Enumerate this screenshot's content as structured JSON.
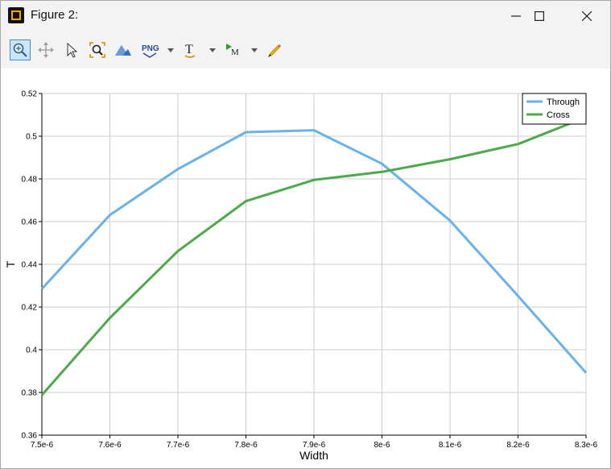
{
  "window": {
    "title": "Figure 2:",
    "minimize_icon": "minimize-icon",
    "maximize_icon": "maximize-icon",
    "close_icon": "close-icon"
  },
  "toolbar": {
    "buttons": [
      {
        "icon": "zoom-icon",
        "active": true
      },
      {
        "icon": "pan-icon",
        "active": false
      },
      {
        "icon": "select-pointer-icon",
        "active": false
      },
      {
        "icon": "zoom-fit-icon",
        "active": false
      },
      {
        "icon": "mountain-3d-icon",
        "active": false
      },
      {
        "icon": "png-export-icon",
        "label": "PNG",
        "dropdown": true
      },
      {
        "icon": "text-tool-icon",
        "label": "T",
        "dropdown": true
      },
      {
        "icon": "marker-tool-icon",
        "label": "M",
        "dropdown": true
      },
      {
        "icon": "pencil-icon",
        "active": false
      }
    ]
  },
  "colors": {
    "through": "#6ab2ea",
    "cross": "#4caa4c",
    "grid": "#cccccc",
    "active_border": "#3b8fd9"
  },
  "chart_data": {
    "type": "line",
    "title": "",
    "xlabel": "Width",
    "ylabel": "T",
    "x": [
      7.5e-06,
      7.6e-06,
      7.7e-06,
      7.8e-06,
      7.9e-06,
      8e-06,
      8.1e-06,
      8.2e-06,
      8.3e-06
    ],
    "x_tick_labels": [
      "7.5e-6",
      "7.6e-6",
      "7.7e-6",
      "7.8e-6",
      "7.9e-6",
      "8e-6",
      "8.1e-6",
      "8.2e-6",
      "8.3e-6"
    ],
    "xlim": [
      7.5e-06,
      8.3e-06
    ],
    "ylim": [
      0.36,
      0.52
    ],
    "y_ticks": [
      0.36,
      0.38,
      0.4,
      0.42,
      0.44,
      0.46,
      0.48,
      0.5,
      0.52
    ],
    "y_tick_labels": [
      "0.36",
      "0.38",
      "0.4",
      "0.42",
      "0.44",
      "0.46",
      "0.48",
      "0.5",
      "0.52"
    ],
    "grid": true,
    "legend_position": "top-right",
    "series": [
      {
        "name": "Through",
        "values": [
          0.4285,
          0.4631,
          0.4846,
          0.5019,
          0.5028,
          0.4871,
          0.4605,
          0.4252,
          0.3892
        ]
      },
      {
        "name": "Cross",
        "values": [
          0.3788,
          0.4149,
          0.4462,
          0.4696,
          0.4795,
          0.4833,
          0.4892,
          0.4963,
          0.5089
        ]
      }
    ]
  }
}
